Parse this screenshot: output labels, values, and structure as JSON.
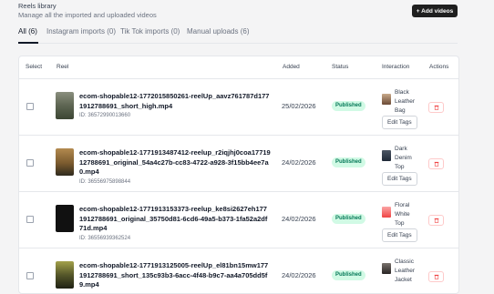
{
  "header": {
    "title": "Reels library",
    "subtitle": "Manage all the imported and uploaded videos",
    "add_button": "+ Add videos"
  },
  "tabs": [
    {
      "label": "All (6)",
      "active": true
    },
    {
      "label": "Instagram imports (0)",
      "active": false
    },
    {
      "label": "Tik Tok imports (0)",
      "active": false
    },
    {
      "label": "Manual uploads (6)",
      "active": false
    }
  ],
  "table": {
    "columns": [
      "Select",
      "Reel",
      "Added",
      "Status",
      "Interaction",
      "Actions"
    ],
    "edit_tags_label": "Edit Tags",
    "rows": [
      {
        "name": "ecom-shopable12-1772015850261-reelUp_aavz761787d1771912788691_short_high.mp4",
        "id": "ID: 36572990013660",
        "added": "25/02/2026",
        "status": "Published",
        "product": "Black Leather Bag"
      },
      {
        "name": "ecom-shopable12-1771913487412-reelup_r2iqjhj0coa1771912788691_original_54a4c27b-cc83-4722-a928-3f15bb4ee7a0.mp4",
        "id": "ID: 36556975898844",
        "added": "24/02/2026",
        "status": "Published",
        "product": "Dark Denim Top"
      },
      {
        "name": "ecom-shopable12-1771913153373-reelup_ke8si2627eh1771912788691_original_35750d81-6cd6-49a5-b373-1fa52a2df71d.mp4",
        "id": "ID: 36556939362524",
        "added": "24/02/2026",
        "status": "Published",
        "product": "Floral White Top"
      },
      {
        "name": "ecom-shopable12-1771913125005-reelUp_el81bn15mw1771912788691_short_135c93b3-6acc-4f48-b9c7-aa4a705dd5f9.mp4",
        "id": "",
        "added": "24/02/2026",
        "status": "Published",
        "product": "Classic Leather Jacket"
      }
    ]
  }
}
